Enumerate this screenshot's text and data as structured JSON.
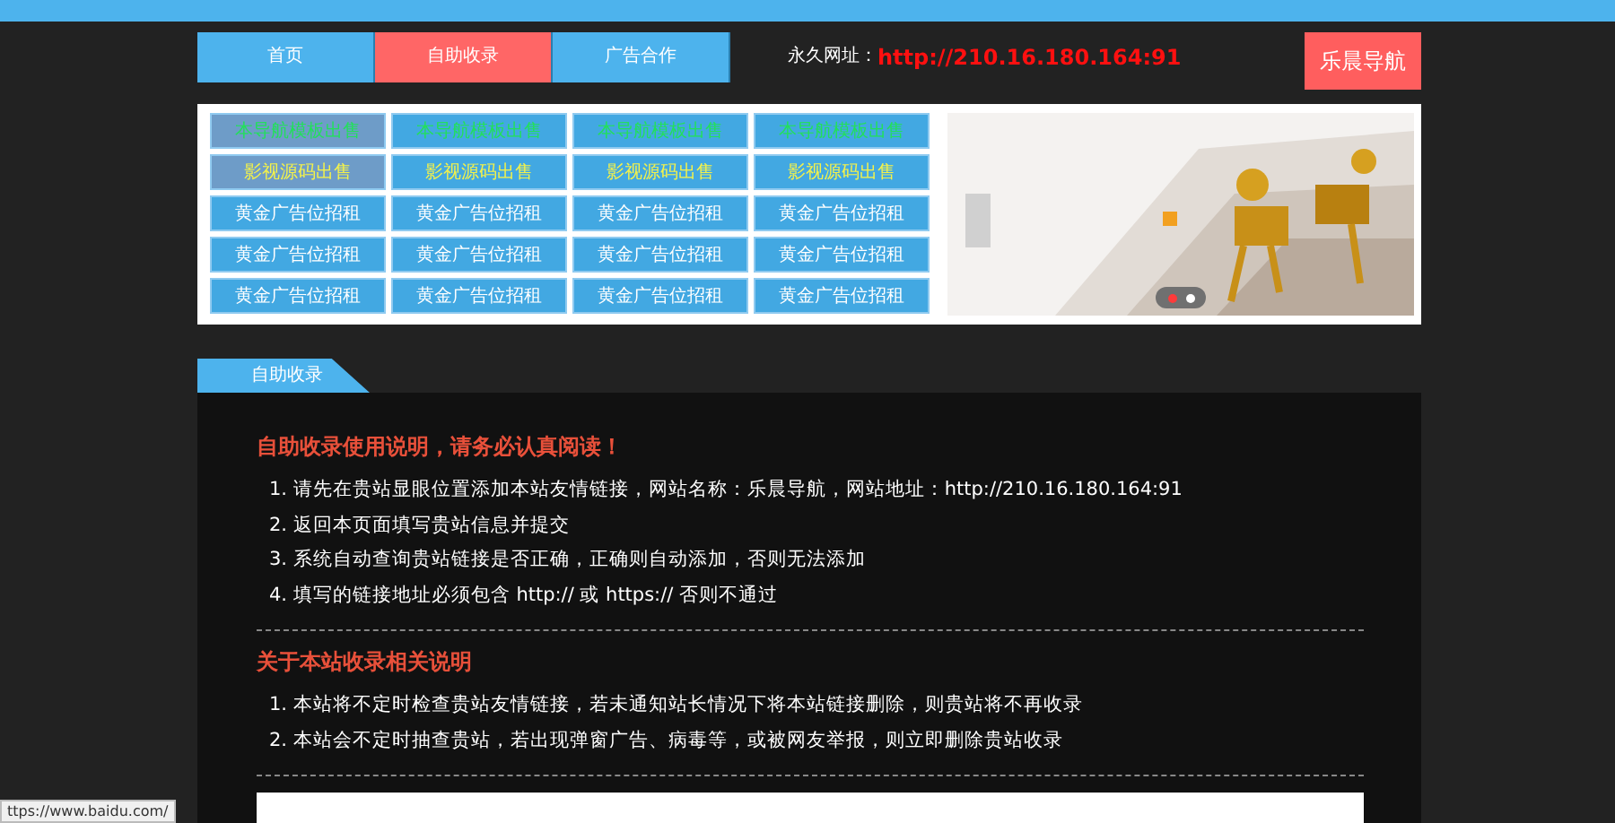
{
  "nav": {
    "items": [
      {
        "label": "首页",
        "selected": false
      },
      {
        "label": "自助收录",
        "selected": true
      },
      {
        "label": "广告合作",
        "selected": false
      }
    ],
    "permalink_label": "永久网址：",
    "permalink": "http://210.16.180.164:91",
    "brand_button": "乐晨导航"
  },
  "link_grid": {
    "rows": [
      {
        "kind": "template",
        "cells": [
          {
            "label": "本导航模板出售",
            "dimmed": true
          },
          {
            "label": "本导航模板出售",
            "dimmed": false
          },
          {
            "label": "本导航模板出售",
            "dimmed": false
          },
          {
            "label": "本导航模板出售",
            "dimmed": false
          }
        ]
      },
      {
        "kind": "source",
        "cells": [
          {
            "label": "影视源码出售",
            "dimmed": true
          },
          {
            "label": "影视源码出售",
            "dimmed": false
          },
          {
            "label": "影视源码出售",
            "dimmed": false
          },
          {
            "label": "影视源码出售",
            "dimmed": false
          }
        ]
      },
      {
        "kind": "ad",
        "cells": [
          {
            "label": "黄金广告位招租",
            "dimmed": false
          },
          {
            "label": "黄金广告位招租",
            "dimmed": false
          },
          {
            "label": "黄金广告位招租",
            "dimmed": false
          },
          {
            "label": "黄金广告位招租",
            "dimmed": false
          }
        ]
      },
      {
        "kind": "ad",
        "cells": [
          {
            "label": "黄金广告位招租",
            "dimmed": false
          },
          {
            "label": "黄金广告位招租",
            "dimmed": false
          },
          {
            "label": "黄金广告位招租",
            "dimmed": false
          },
          {
            "label": "黄金广告位招租",
            "dimmed": false
          }
        ]
      },
      {
        "kind": "ad",
        "cells": [
          {
            "label": "黄金广告位招租",
            "dimmed": false
          },
          {
            "label": "黄金广告位招租",
            "dimmed": false
          },
          {
            "label": "黄金广告位招租",
            "dimmed": false
          },
          {
            "label": "黄金广告位招租",
            "dimmed": false
          }
        ]
      }
    ]
  },
  "banner": {
    "slides": [
      {
        "selected": true
      },
      {
        "selected": false
      }
    ]
  },
  "section_tab": "自助收录",
  "sections": [
    {
      "heading": "自助收录使用说明，请务必认真阅读！",
      "items": [
        "1. 请先在贵站显眼位置添加本站友情链接，网站名称：乐晨导航，网站地址：http://210.16.180.164:91",
        "2. 返回本页面填写贵站信息并提交",
        "3. 系统自动查询贵站链接是否正确，正确则自动添加，否则无法添加",
        "4. 填写的链接地址必须包含 http:// 或 https:// 否则不通过"
      ]
    },
    {
      "heading": "关于本站收录相关说明",
      "items": [
        "1. 本站将不定时检查贵站友情链接，若未通知站长情况下将本站链接删除，则贵站将不再收录",
        "2. 本站会不定时抽查贵站，若出现弹窗广告、病毒等，或被网友举报，则立即删除贵站收录"
      ]
    }
  ],
  "status_bar": "ttps://www.baidu.com/"
}
